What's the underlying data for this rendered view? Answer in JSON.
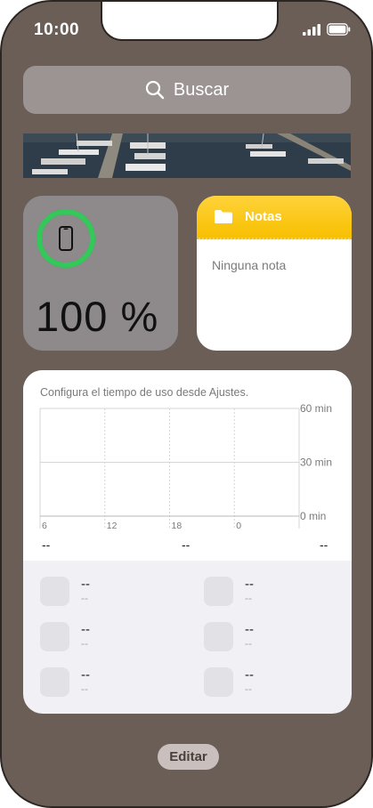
{
  "status_bar": {
    "time": "10:00",
    "icons": [
      "signal-icon",
      "battery-icon"
    ]
  },
  "search": {
    "placeholder": "Buscar",
    "icon": "search-icon"
  },
  "battery_widget": {
    "percent_label": "100 %",
    "level": 1.0,
    "icon": "iphone-icon",
    "ring_color": "#34c759"
  },
  "notes_widget": {
    "title": "Notas",
    "empty_text": "Ninguna nota",
    "icon": "folder-icon",
    "accent": "#f7c000"
  },
  "screen_time_widget": {
    "note": "Configura el tiempo de uso desde Ajustes.",
    "chart_data": {
      "type": "bar",
      "x_ticks": [
        "6",
        "12",
        "18",
        "0"
      ],
      "y_ticks": [
        "60 min",
        "30 min",
        "0 min"
      ],
      "ylim": [
        0,
        60
      ],
      "values": [],
      "grid": true
    },
    "summary": [
      "--",
      "--",
      "--"
    ],
    "apps": [
      {
        "main": "--",
        "sub": "--"
      },
      {
        "main": "--",
        "sub": "--"
      },
      {
        "main": "--",
        "sub": "--"
      },
      {
        "main": "--",
        "sub": "--"
      },
      {
        "main": "--",
        "sub": "--"
      },
      {
        "main": "--",
        "sub": "--"
      }
    ]
  },
  "edit_button": {
    "label": "Editar"
  },
  "colors": {
    "background": "#6b5e57",
    "widget_gray": "#8e8a8c",
    "search_bg": "#9b9492"
  }
}
